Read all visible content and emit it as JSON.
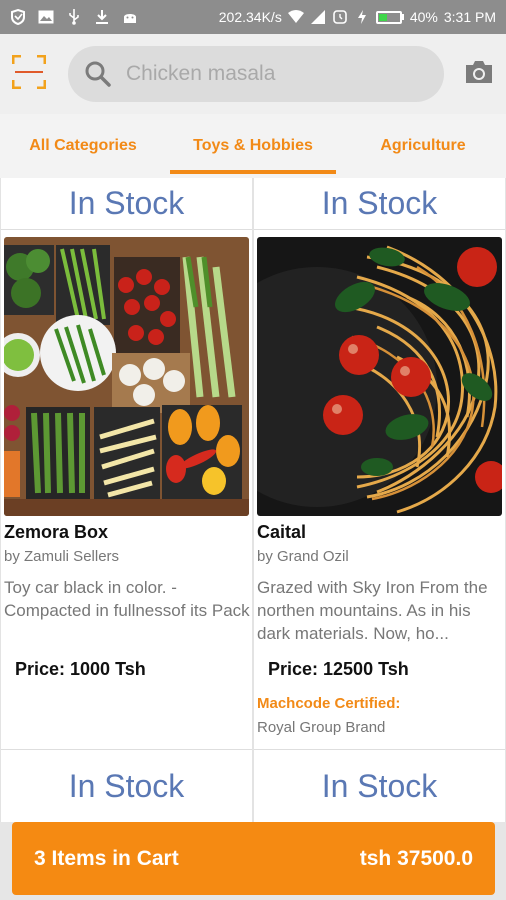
{
  "status_bar": {
    "speed": "202.34K/s",
    "battery": "40%",
    "battery_level": 0.4,
    "time": "3:31 PM",
    "icons": [
      "shield-icon",
      "image-icon",
      "usb-icon",
      "download-icon",
      "android-icon",
      "wifi-icon",
      "signal-icon",
      "alarm-icon",
      "charging-icon",
      "battery-icon"
    ]
  },
  "toolbar": {
    "search_placeholder": "Chicken masala",
    "icons": [
      "barcode-scan-icon",
      "search-icon",
      "camera-icon"
    ]
  },
  "tabs": [
    {
      "label": "All Categories",
      "active": false
    },
    {
      "label": "Toys & Hobbies",
      "active": true
    },
    {
      "label": "Agriculture",
      "active": false
    }
  ],
  "products": [
    {
      "stock_top": "In Stock",
      "image": "vegetables-photo",
      "name": "Zemora Box",
      "seller": "by Zamuli Sellers",
      "description": "Toy car black in color. -Compacted in fullnessof its Pack",
      "price": "Price: 1000 Tsh",
      "certified": "",
      "brand": "",
      "stock_bottom": "In Stock"
    },
    {
      "stock_top": "In Stock",
      "image": "spaghetti-photo",
      "name": "Caital",
      "seller": "by Grand Ozil",
      "description": "Grazed with Sky Iron From the northen mountains. As in his dark materials. Now, ho...",
      "price": "Price: 12500 Tsh",
      "certified": "Machcode Certified:",
      "brand": "Royal Group Brand",
      "stock_bottom": "In Stock"
    }
  ],
  "cart": {
    "items_label": "3 Items in Cart",
    "total": "tsh 37500.0"
  },
  "colors": {
    "accent": "#f28a17",
    "cart_bg": "#f58a12",
    "stock_text": "#5a78b4",
    "status_bar": "#8d8d8d"
  }
}
